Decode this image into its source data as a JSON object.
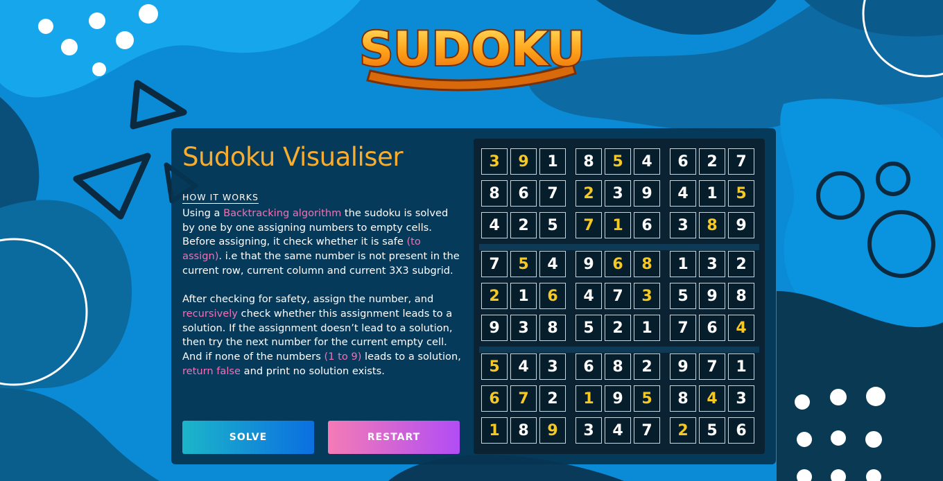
{
  "app": {
    "logo_text": "SUDOKU",
    "title": "Sudoku Visualiser"
  },
  "info": {
    "heading": "HOW IT WORKS",
    "p1": {
      "t1": "Using a ",
      "h1": "Backtracking algorithm",
      "t2": " the sudoku is solved by one by one assigning numbers to empty cells. Before assigning, it check whether it is safe ",
      "h2": "(to assign)",
      "t3": ". i.e that the same number is not present in the current row, current column and current 3X3 subgrid."
    },
    "p2": {
      "t1": "After checking for safety, assign the number, and ",
      "h1": "recursively",
      "t2": " check whether this assignment leads to a solution. If the assignment doesn’t lead to a solution, then try the next number for the current empty cell. And if none of the numbers ",
      "h2": "(1 to 9)",
      "t3": " leads to a solution, ",
      "h3": "return false",
      "t4": " and print no solution exists."
    }
  },
  "buttons": {
    "solve": "SOLVE",
    "restart": "RESTART"
  },
  "grid": [
    [
      3,
      9,
      1,
      8,
      5,
      4,
      6,
      2,
      7
    ],
    [
      8,
      6,
      7,
      2,
      3,
      9,
      4,
      1,
      5
    ],
    [
      4,
      2,
      5,
      7,
      1,
      6,
      3,
      8,
      9
    ],
    [
      7,
      5,
      4,
      9,
      6,
      8,
      1,
      3,
      2
    ],
    [
      2,
      1,
      6,
      4,
      7,
      3,
      5,
      9,
      8
    ],
    [
      9,
      3,
      8,
      5,
      2,
      1,
      7,
      6,
      4
    ],
    [
      5,
      4,
      3,
      6,
      8,
      2,
      9,
      7,
      1
    ],
    [
      6,
      7,
      2,
      1,
      9,
      5,
      8,
      4,
      3
    ],
    [
      1,
      8,
      9,
      3,
      4,
      7,
      2,
      5,
      6
    ]
  ],
  "given": [
    [
      1,
      1,
      0,
      0,
      1,
      0,
      0,
      0,
      0
    ],
    [
      0,
      0,
      0,
      1,
      0,
      0,
      0,
      0,
      1
    ],
    [
      0,
      0,
      0,
      1,
      1,
      0,
      0,
      1,
      0
    ],
    [
      0,
      1,
      0,
      0,
      1,
      1,
      0,
      0,
      0
    ],
    [
      1,
      0,
      1,
      0,
      0,
      1,
      0,
      0,
      0
    ],
    [
      0,
      0,
      0,
      0,
      0,
      0,
      0,
      0,
      1
    ],
    [
      1,
      0,
      0,
      0,
      0,
      0,
      0,
      0,
      0
    ],
    [
      1,
      1,
      0,
      1,
      0,
      1,
      0,
      1,
      0
    ],
    [
      1,
      0,
      1,
      0,
      0,
      0,
      1,
      0,
      0
    ]
  ],
  "colors": {
    "accent_orange": "#f9ad2f",
    "highlight_pink": "#f072b5",
    "given_digit": "#f6c824",
    "solved_digit": "#ffffff"
  }
}
